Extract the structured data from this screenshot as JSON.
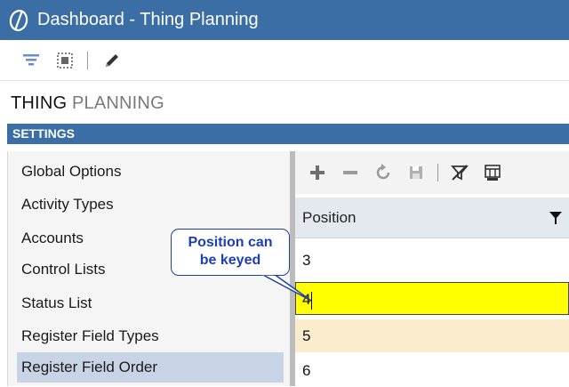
{
  "window": {
    "title": "Dashboard - Thing Planning"
  },
  "toolbar": {
    "icons": [
      "filter-icon",
      "select-area-icon",
      "pencil-icon"
    ]
  },
  "page": {
    "title_strong": "THING",
    "title_light": " PLANNING"
  },
  "section": {
    "label": "SETTINGS"
  },
  "settings_list": [
    {
      "label": "Global Options",
      "selected": false
    },
    {
      "label": "Activity Types",
      "selected": false
    },
    {
      "label": "Accounts",
      "selected": false
    },
    {
      "label": "Control Lists",
      "selected": false
    },
    {
      "label": "Status List",
      "selected": false
    },
    {
      "label": "Register Field Types",
      "selected": false
    },
    {
      "label": "Register Field Order",
      "selected": true
    }
  ],
  "grid_toolbar": {
    "icons": [
      "add-icon",
      "remove-icon",
      "refresh-icon",
      "save-icon",
      "clear-filter-icon",
      "column-chooser-icon"
    ]
  },
  "grid": {
    "column_header": "Position",
    "rows": [
      "3",
      "4",
      "5",
      "6"
    ],
    "editing_row_index": 1
  },
  "callout": {
    "line1": "Position can",
    "line2": "be keyed"
  },
  "colors": {
    "header_blue": "#3a6ea5",
    "selection": "#c9d3e6",
    "editing": "#ffff00",
    "row_alt": "#fbeccd",
    "callout_text": "#1c3fb8"
  }
}
